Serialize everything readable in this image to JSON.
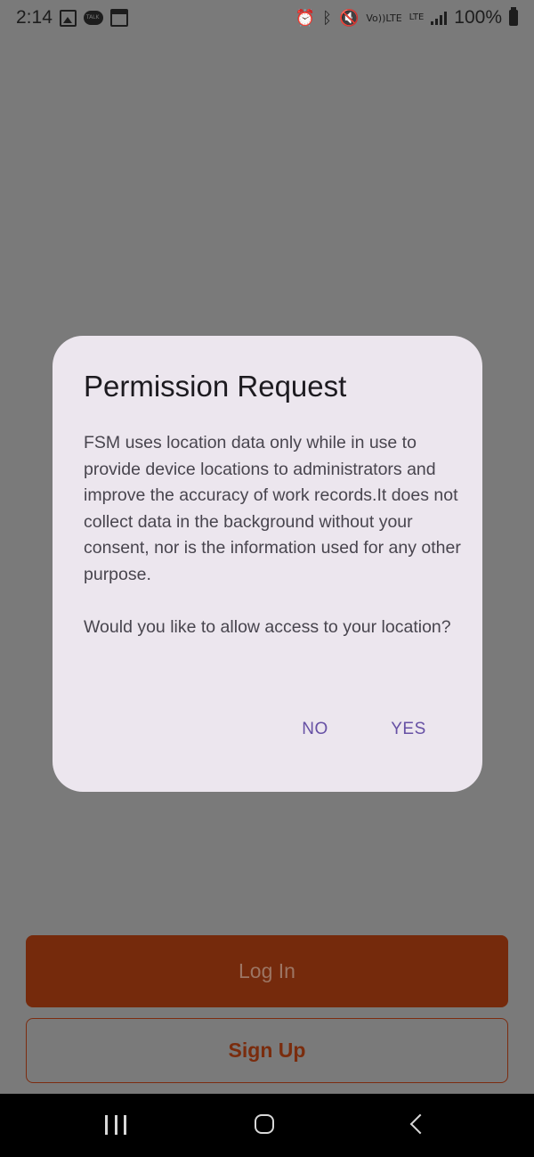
{
  "status_bar": {
    "time": "2:14",
    "battery_percent": "100%",
    "network_label": "LTE",
    "volte_label": "Vo))LTE",
    "left_icons": [
      "image-icon",
      "chat-icon",
      "note-icon"
    ],
    "right_icons": [
      "alarm-icon",
      "bluetooth-icon",
      "mute-icon",
      "volte-icon",
      "lte-icon",
      "signal-icon",
      "battery-icon"
    ]
  },
  "dialog": {
    "title": "Permission Request",
    "paragraph1": "FSM uses location data only while in use to provide device locations to administrators and improve the accuracy of work records.It does not collect data in the background without your consent, nor is the information used for any other purpose.",
    "paragraph2": "Would you like to allow access to your location?",
    "no_label": "NO",
    "yes_label": "YES"
  },
  "app": {
    "login_label": "Log In",
    "signup_label": "Sign Up"
  },
  "colors": {
    "scrim": "#7a7a7a",
    "dialog_bg": "#ece6ee",
    "dialog_button_text": "#6650a4",
    "login_bg": "#752a0c",
    "signup_border": "#7c2c10",
    "nav_bar": "#000000"
  },
  "nav_bar": {
    "icons": [
      "recent-apps-icon",
      "home-icon",
      "back-icon"
    ]
  }
}
